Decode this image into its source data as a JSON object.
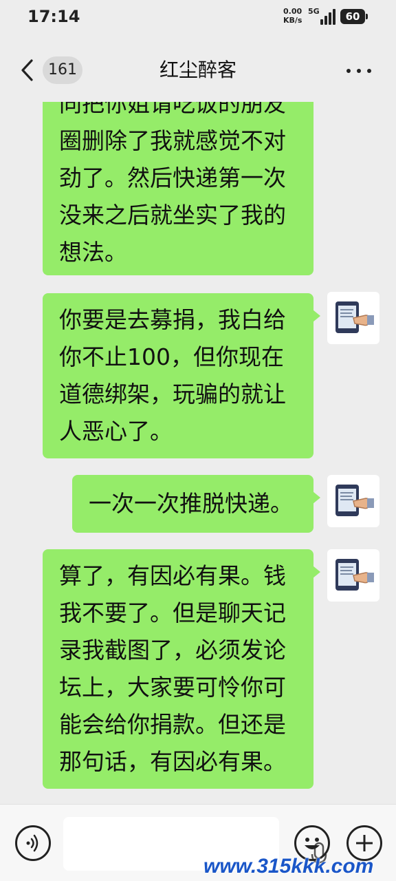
{
  "status_bar": {
    "time": "17:14",
    "net_speed": "0.00",
    "net_unit": "KB/s",
    "network_type": "5G",
    "battery": "60"
  },
  "header": {
    "back_icon": "chevron-left-icon",
    "unread_count": "161",
    "title": "红尘醉客",
    "more_icon": "more-dots-icon"
  },
  "messages": [
    {
      "sender": "other",
      "lines": [
        "同把你姐请吃饭的朋友",
        "圈删除了我就感觉不对",
        "劲了。然后快递第一次",
        "没来之后就坐实了我的",
        "想法。"
      ]
    },
    {
      "sender": "me",
      "lines": [
        "你要是去募捐，我白给",
        "你不止100，但你现在",
        "道德绑架，玩骗的就让",
        "人恶心了。"
      ]
    },
    {
      "sender": "me",
      "lines": [
        "一次一次推脱快递。"
      ]
    },
    {
      "sender": "me",
      "lines": [
        "算了，有因必有果。钱",
        "我不要了。但是聊天记",
        "录我截图了，必须发论",
        "坛上，大家要可怜你可",
        "能会给你捐款。但还是",
        "那句话，有因必有果。"
      ]
    }
  ],
  "input_bar": {
    "voice_icon": "voice-icon",
    "mic_icon": "mic-icon",
    "emoji_icon": "emoji-icon",
    "plus_icon": "plus-icon"
  },
  "watermark": "www.315kkk.com",
  "colors": {
    "bubble": "#95ec69",
    "background": "#ededed"
  }
}
